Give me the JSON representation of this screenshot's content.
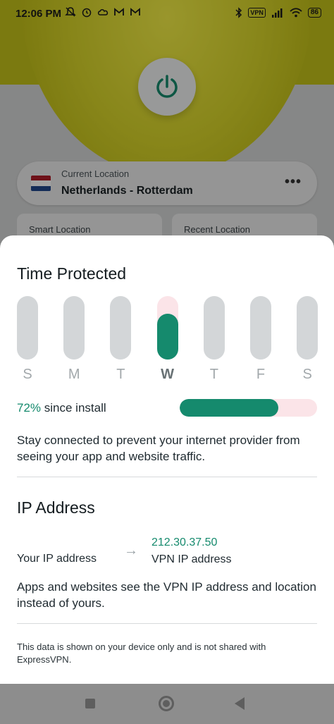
{
  "status_bar": {
    "time": "12:06 PM",
    "left_icons": [
      "mute-icon",
      "alarm-icon",
      "cloud-icon",
      "gmail-icon",
      "gmail-icon"
    ],
    "vpn_badge": "VPN",
    "battery": "86"
  },
  "background": {
    "current_location_label": "Current Location",
    "current_location_value": "Netherlands - Rotterdam",
    "more_glyph": "•••",
    "smart_location_label": "Smart Location",
    "recent_location_label": "Recent Location",
    "flag_colors": [
      "#ae1c28",
      "#ffffff",
      "#21468b"
    ]
  },
  "sheet": {
    "time_protected_title": "Time Protected",
    "days": [
      {
        "label": "S",
        "fill": 0,
        "today": false
      },
      {
        "label": "M",
        "fill": 0,
        "today": false
      },
      {
        "label": "T",
        "fill": 0,
        "today": false
      },
      {
        "label": "W",
        "fill": 0.72,
        "today": true
      },
      {
        "label": "T",
        "fill": 0,
        "today": false
      },
      {
        "label": "F",
        "fill": 0,
        "today": false
      },
      {
        "label": "S",
        "fill": 0,
        "today": false
      }
    ],
    "percent": "72%",
    "since_install": " since install",
    "progress_fraction": 0.72,
    "protect_message": "Stay connected to prevent your internet provider from seeing your app and website traffic.",
    "ip_title": "IP Address",
    "your_ip_label": "Your IP address",
    "vpn_ip_value": "212.30.37.50",
    "vpn_ip_label": "VPN IP address",
    "ip_message": "Apps and websites see the VPN IP address and location instead of yours.",
    "footnote": "This data is shown on your device only and is not shared with ExpressVPN."
  },
  "colors": {
    "accent": "#158a6d",
    "bar_empty": "#d3d6d8",
    "bar_today_bg": "#fbe4e8"
  }
}
